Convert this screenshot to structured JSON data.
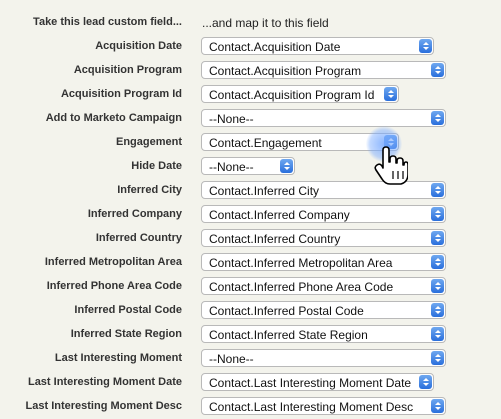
{
  "header": {
    "left": "Take this lead custom field...",
    "right": "...and map it to this field"
  },
  "rows": [
    {
      "label": "Acquisition Date",
      "value": "Contact.Acquisition Date"
    },
    {
      "label": "Acquisition Program",
      "value": "Contact.Acquisition Program"
    },
    {
      "label": "Acquisition Program Id",
      "value": "Contact.Acquisition Program Id"
    },
    {
      "label": "Add to Marketo Campaign",
      "value": "--None--"
    },
    {
      "label": "Engagement",
      "value": "Contact.Engagement"
    },
    {
      "label": "Hide Date",
      "value": "--None--"
    },
    {
      "label": "Inferred City",
      "value": "Contact.Inferred City"
    },
    {
      "label": "Inferred Company",
      "value": "Contact.Inferred Company"
    },
    {
      "label": "Inferred Country",
      "value": "Contact.Inferred Country"
    },
    {
      "label": "Inferred Metropolitan Area",
      "value": "Contact.Inferred Metropolitan Area"
    },
    {
      "label": "Inferred Phone Area Code",
      "value": "Contact.Inferred Phone Area Code"
    },
    {
      "label": "Inferred Postal Code",
      "value": "Contact.Inferred Postal Code"
    },
    {
      "label": "Inferred State Region",
      "value": "Contact.Inferred State Region"
    },
    {
      "label": "Last Interesting Moment",
      "value": "--None--"
    },
    {
      "label": "Last Interesting Moment Date",
      "value": "Contact.Last Interesting Moment Date"
    },
    {
      "label": "Last Interesting Moment Desc",
      "value": "Contact.Last Interesting Moment Desc"
    }
  ],
  "colors": {
    "background": "#f3f3ec",
    "select_arrow": "#2a6fdc",
    "hover_glow": "#78aaff"
  },
  "icons": {
    "select_arrow": "up-down-chevron-icon",
    "cursor": "hand-pointer-icon"
  }
}
